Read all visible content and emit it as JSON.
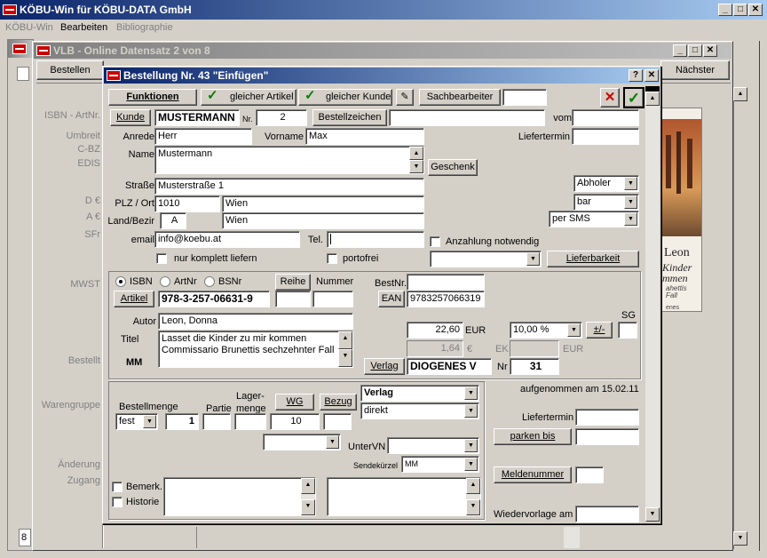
{
  "app": {
    "title": "KÖBU-Win für KÖBU-DATA GmbH",
    "menu": [
      "KÖBU-Win",
      "Bearbeiten",
      "Bibliographie"
    ]
  },
  "vlb": {
    "title": "VLB - Online  Datensatz 2 von 8",
    "bestellen": "Bestellen",
    "naechster": "Nächster",
    "labels": [
      "ISBN - ArtNr.",
      "Umbreit",
      "C-BZ",
      "EDIS",
      "D €",
      "A €",
      "SFr",
      "MWST",
      "Bestellt",
      "Warengruppe",
      "Änderung",
      "Zugang"
    ],
    "page": "8"
  },
  "cover": {
    "author": "Leon",
    "title_l1": "Kinder",
    "title_l2": "mmen",
    "sub": "ahettis",
    "sub2": "Fall",
    "pub": "enes"
  },
  "dlg": {
    "title": "Bestellung Nr. 43 \"Einfügen\"",
    "toolbar": {
      "funktionen": "Funktionen",
      "gleicher_artikel": "gleicher Artikel",
      "gleicher_kunde": "gleicher Kunde",
      "sachbearbeiter": "Sachbearbeiter"
    },
    "kunde": {
      "btn": "Kunde",
      "name": "MUSTERMANN",
      "nr_label": "Nr.",
      "nr": "2",
      "bestellzeichen": "Bestellzeichen",
      "vom": "vom",
      "liefertermin": "Liefertermin",
      "anrede_label": "Anrede",
      "anrede": "Herr",
      "vorname_label": "Vorname",
      "vorname": "Max",
      "name_label": "Name",
      "name_val": "Mustermann",
      "geschenk": "Geschenk",
      "strasse_label": "Straße",
      "strasse": "Musterstraße 1",
      "plz_label": "PLZ / Ort",
      "plz": "1010",
      "ort": "Wien",
      "land_label": "Land/Bezir",
      "land": "A",
      "bezirk": "Wien",
      "email_label": "email",
      "email": "info@koebu.at",
      "tel_label": "Tel.",
      "abholer": "Abholer",
      "bar": "bar",
      "per_sms": "per SMS",
      "anzahlung": "Anzahlung notwendig",
      "nur_komplett": "nur komplett liefern",
      "portofrei": "portofrei",
      "lieferbarkeit": "Lieferbarkeit"
    },
    "artikel": {
      "isbn": "ISBN",
      "artnr": "ArtNr",
      "bsnr": "BSNr",
      "reihe": "Reihe",
      "nummer": "Nummer",
      "bestnr": "BestNr.",
      "artikel_btn": "Artikel",
      "isbn_val": "978-3-257-06631-9",
      "ean": "EAN",
      "ean_val": "9783257066319",
      "autor_label": "Autor",
      "autor": "Leon, Donna",
      "titel_label": "Titel",
      "titel_l1": "Lasset die Kinder zu mir kommen",
      "titel_l2": "Commissario Brunettis sechzehnter Fall",
      "mm": "MM",
      "preis": "22,60",
      "eur": "EUR",
      "preis2": "1,64",
      "euro_sign": "€",
      "ek": "EK",
      "eur2": "EUR",
      "mwst": "10,00 %",
      "plusminus": "±/-",
      "sg": "SG",
      "verlag_btn": "Verlag",
      "verlag": "DIOGENES V",
      "nr_label": "Nr",
      "nr": "31"
    },
    "bestell": {
      "menge_label": "Bestellmenge",
      "partie": "Partie",
      "lager": "Lager-",
      "menge": "menge",
      "wg": "WG",
      "bezug": "Bezug",
      "fest": "fest",
      "menge_val": "1",
      "lager_val": "10",
      "verlag_sel": "Verlag",
      "direkt": "direkt",
      "untervn": "UnterVN",
      "sendekuerzel": "Sendekürzel",
      "sendekuerzel_val": "MM",
      "aufgenommen": "aufgenommen am 15.02.11",
      "liefertermin": "Liefertermin",
      "parken_bis": "parken bis",
      "meldenummer": "Meldenummer",
      "bemerk": "Bemerk.",
      "historie": "Historie",
      "wiedervorlage": "Wiedervorlage am"
    }
  }
}
